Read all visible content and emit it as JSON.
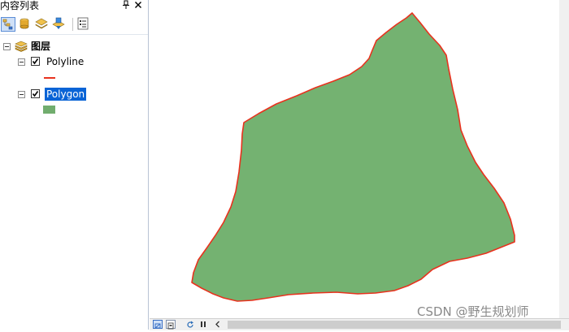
{
  "toc": {
    "title": "内容列表",
    "pin_glyph": "⊥",
    "close_glyph": "✕",
    "toolbar": [
      {
        "name": "list-by-drawing-order-button",
        "icon": "layers-list-icon",
        "active": true
      },
      {
        "name": "list-by-source-button",
        "icon": "database-icon",
        "active": false
      },
      {
        "name": "list-by-visibility-button",
        "icon": "layer-visibility-icon",
        "active": false
      },
      {
        "name": "list-by-selection-button",
        "icon": "layer-selection-icon",
        "active": false
      },
      {
        "name": "options-button",
        "icon": "options-list-icon",
        "active": false
      }
    ],
    "root": {
      "label": "图层",
      "icon": "layers-stack-icon"
    },
    "layers": [
      {
        "label": "Polyline",
        "checked": true,
        "symbol": "line",
        "symbol_color": "#e8321e",
        "selected": false
      },
      {
        "label": "Polygon",
        "checked": true,
        "symbol": "fill",
        "symbol_color": "#71ad6e",
        "selected": true
      }
    ]
  },
  "map": {
    "polygon_fill": "#74b271",
    "polygon_outline": "#e8321e"
  },
  "watermark": "CSDN @野生规划师"
}
